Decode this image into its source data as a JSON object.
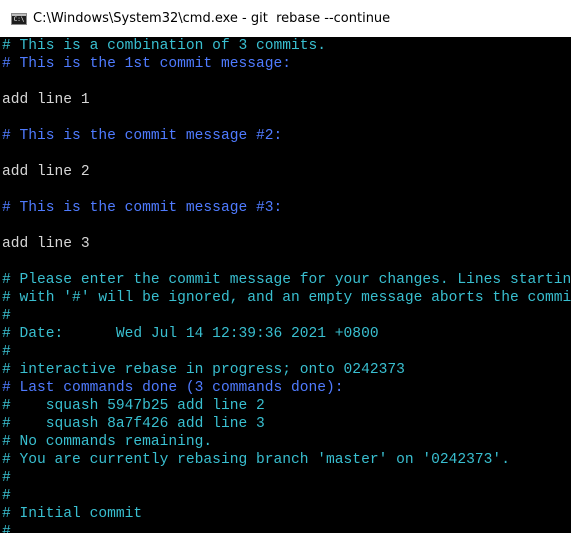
{
  "window": {
    "title": "C:\\Windows\\System32\\cmd.exe - git  rebase --continue",
    "icon": "cmd-console-icon"
  },
  "colors": {
    "background": "#000000",
    "comment": "#39bfd0",
    "highlight": "#4f7bff",
    "text": "#d6d6d6"
  },
  "console": {
    "lines": [
      {
        "text": "# This is a combination of 3 commits.",
        "color": "#39bfd0"
      },
      {
        "text": "# This is the 1st commit message:",
        "color": "#4f7bff"
      },
      {
        "text": "",
        "color": "#d6d6d6"
      },
      {
        "text": "add line 1",
        "color": "#d6d6d6"
      },
      {
        "text": "",
        "color": "#d6d6d6"
      },
      {
        "text": "# This is the commit message #2:",
        "color": "#4f7bff"
      },
      {
        "text": "",
        "color": "#d6d6d6"
      },
      {
        "text": "add line 2",
        "color": "#d6d6d6"
      },
      {
        "text": "",
        "color": "#d6d6d6"
      },
      {
        "text": "# This is the commit message #3:",
        "color": "#4f7bff"
      },
      {
        "text": "",
        "color": "#d6d6d6"
      },
      {
        "text": "add line 3",
        "color": "#d6d6d6"
      },
      {
        "text": "",
        "color": "#d6d6d6"
      },
      {
        "text": "# Please enter the commit message for your changes. Lines starting",
        "color": "#39bfd0"
      },
      {
        "text": "# with '#' will be ignored, and an empty message aborts the commit.",
        "color": "#39bfd0"
      },
      {
        "text": "#",
        "color": "#39bfd0"
      },
      {
        "text": "# Date:      Wed Jul 14 12:39:36 2021 +0800",
        "color": "#39bfd0"
      },
      {
        "text": "#",
        "color": "#39bfd0"
      },
      {
        "text": "# interactive rebase in progress; onto 0242373",
        "color": "#39bfd0"
      },
      {
        "text": "# Last commands done (3 commands done):",
        "color": "#4f7bff"
      },
      {
        "text": "#    squash 5947b25 add line 2",
        "color": "#39bfd0"
      },
      {
        "text": "#    squash 8a7f426 add line 3",
        "color": "#39bfd0"
      },
      {
        "text": "# No commands remaining.",
        "color": "#39bfd0"
      },
      {
        "text": "# You are currently rebasing branch 'master' on '0242373'.",
        "color": "#39bfd0"
      },
      {
        "text": "#",
        "color": "#39bfd0"
      },
      {
        "text": "#",
        "color": "#39bfd0"
      },
      {
        "text": "# Initial commit",
        "color": "#39bfd0"
      },
      {
        "text": "#",
        "color": "#39bfd0"
      }
    ]
  }
}
